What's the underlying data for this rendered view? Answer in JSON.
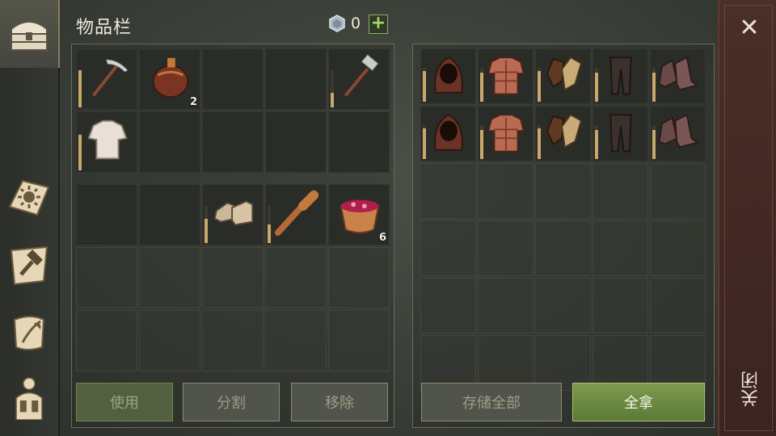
{
  "header": {
    "title": "物品栏",
    "currency_count": "0",
    "add_label": "+"
  },
  "rail": {
    "items": [
      "inventory-chest-icon",
      "journal-sun-icon",
      "crafting-hammer-icon",
      "scroll-quill-icon",
      "character-backpack-icon"
    ]
  },
  "inventory": {
    "hotbar": [
      {
        "item": "pickaxe",
        "durability": 1.0,
        "count": ""
      },
      {
        "item": "flask",
        "durability": null,
        "count": "2"
      },
      {
        "item": "",
        "durability": null,
        "count": ""
      },
      {
        "item": "",
        "durability": null,
        "count": ""
      },
      {
        "item": "hammer",
        "durability": 0.4,
        "count": ""
      },
      {
        "item": "shirt",
        "durability": 0.95,
        "count": ""
      },
      {
        "item": "",
        "durability": null,
        "count": ""
      },
      {
        "item": "",
        "durability": null,
        "count": ""
      },
      {
        "item": "",
        "durability": null,
        "count": ""
      },
      {
        "item": "",
        "durability": null,
        "count": ""
      }
    ],
    "bag": [
      {
        "item": "",
        "durability": null,
        "count": ""
      },
      {
        "item": "",
        "durability": null,
        "count": ""
      },
      {
        "item": "boots-light",
        "durability": 0.65,
        "count": ""
      },
      {
        "item": "club",
        "durability": 0.5,
        "count": ""
      },
      {
        "item": "berry-bowl",
        "durability": null,
        "count": "6"
      }
    ]
  },
  "storage": {
    "items": [
      {
        "item": "hood",
        "durability": 0.9
      },
      {
        "item": "chest-armor",
        "durability": 0.85
      },
      {
        "item": "gloves",
        "durability": 0.9
      },
      {
        "item": "pants",
        "durability": 0.85
      },
      {
        "item": "boots",
        "durability": 0.85
      },
      {
        "item": "hood",
        "durability": 0.9
      },
      {
        "item": "chest-armor",
        "durability": 0.85
      },
      {
        "item": "gloves",
        "durability": 0.9
      },
      {
        "item": "pants",
        "durability": 0.85
      },
      {
        "item": "boots",
        "durability": 0.85
      }
    ]
  },
  "buttons": {
    "use": "使用",
    "split": "分割",
    "remove": "移除",
    "store_all": "存储全部",
    "take_all": "全拿"
  },
  "close": {
    "label": "关闭",
    "x": "✕"
  }
}
